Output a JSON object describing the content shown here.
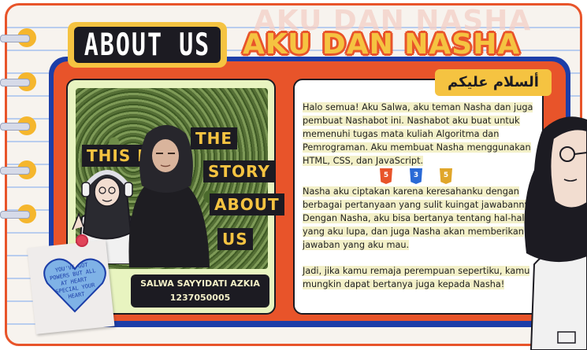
{
  "header": {
    "badge_label": "ABOUT US",
    "title": "AKU DAN NASHA",
    "ghost_title": "AKU DAN NASHA",
    "greeting": "ألسلام عليكم"
  },
  "photo": {
    "story_words": [
      "THE",
      "THIS IS",
      "STORY",
      "ABOUT",
      "US"
    ],
    "name": "SALWA SAYYIDATI AZKIA",
    "id": "1237050005"
  },
  "note": {
    "text": "YOU'VE GOT POWERS BUT ALL AT HEART SPECIAL YOUR HEART"
  },
  "content": {
    "paragraphs": [
      "Halo semua! Aku Salwa, aku teman Nasha dan juga pembuat Nashabot ini. Nashabot aku buat untuk memenuhi tugas mata kuliah Algoritma dan Pemrograman. Aku membuat Nasha menggunakan HTML, CSS, dan JavaScript.",
      "Nasha aku ciptakan karena keresahanku dengan berbagai pertanyaan yang sulit kuingat jawabannya. Dengan Nasha, aku bisa bertanya tentang hal-hal yang aku lupa, dan juga Nasha akan memberikan jawaban yang aku mau.",
      "Jadi, jika kamu remaja perempuan sepertiku, kamu mungkin dapat bertanya juga kepada Nasha!"
    ],
    "tech_icons": [
      {
        "name": "html5-icon",
        "label": "5",
        "color": "#e8542a"
      },
      {
        "name": "css3-icon",
        "label": "3",
        "color": "#2a6ad6"
      },
      {
        "name": "javascript-icon",
        "label": "5",
        "color": "#e0a62a"
      }
    ]
  },
  "colors": {
    "orange": "#e8542a",
    "yellow": "#f5c341",
    "blue": "#1c3ea8",
    "dark": "#1c1b22"
  }
}
